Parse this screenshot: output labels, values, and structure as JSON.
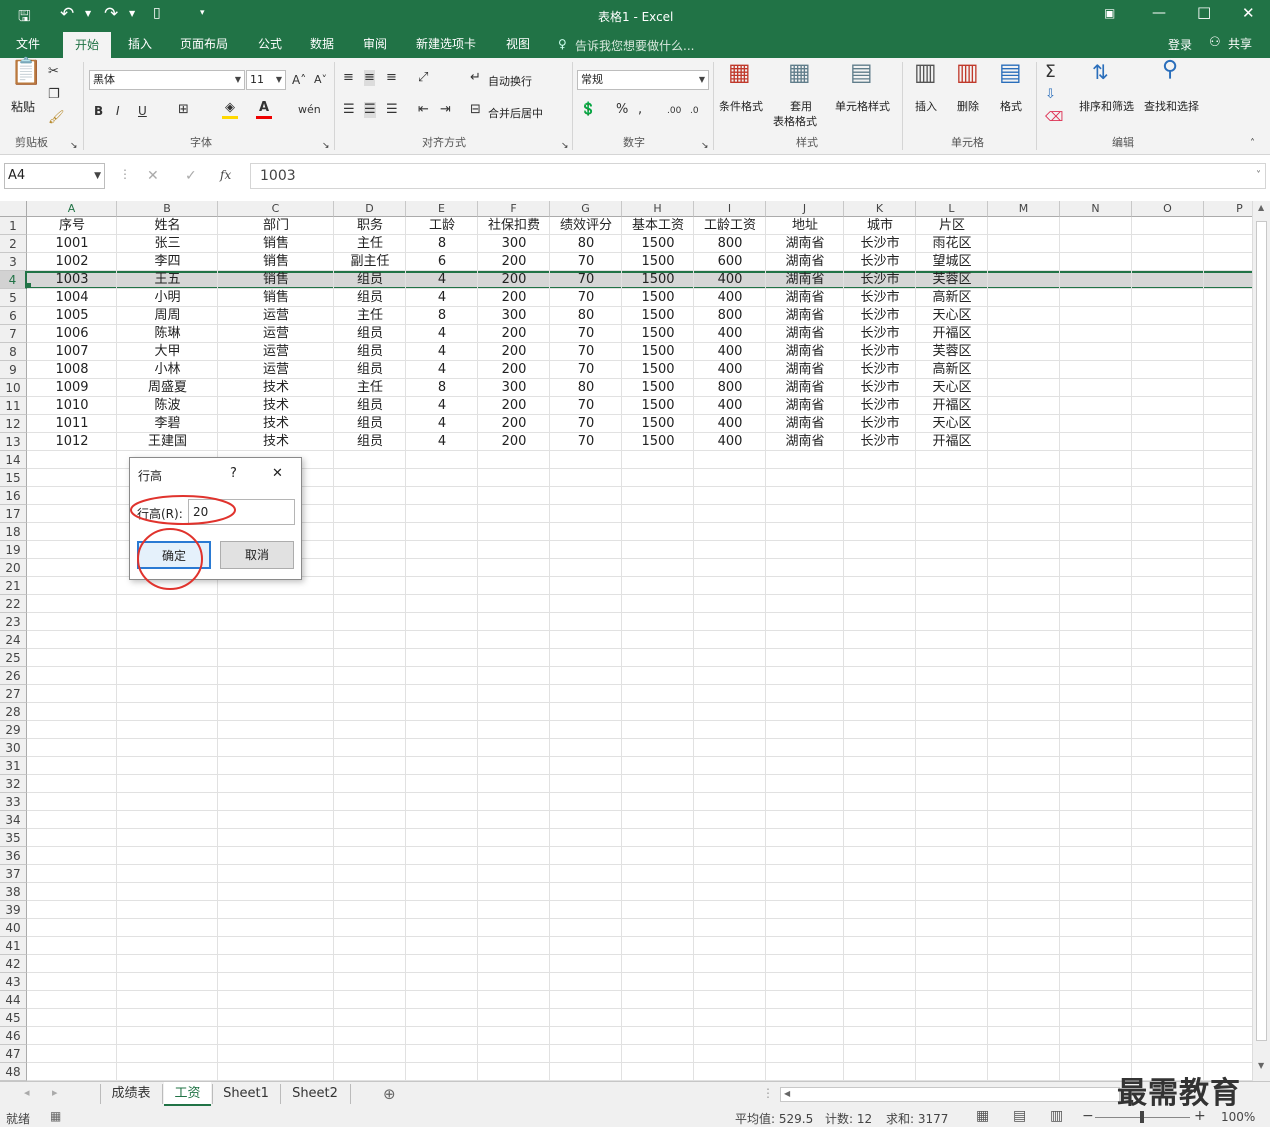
{
  "window": {
    "title": "表格1 - Excel"
  },
  "tabs": [
    "文件",
    "开始",
    "插入",
    "页面布局",
    "公式",
    "数据",
    "审阅",
    "新建选项卡",
    "视图"
  ],
  "tell_me": "告诉我您想要做什么...",
  "account": {
    "login": "登录",
    "share": "共享"
  },
  "ribbon": {
    "clipboard": {
      "label": "剪贴板",
      "paste": "粘贴"
    },
    "font": {
      "label": "字体",
      "name": "黑体",
      "size": "11",
      "bold": "B",
      "italic": "I",
      "underline": "U"
    },
    "alignment": {
      "label": "对齐方式",
      "wrap": "自动换行",
      "merge": "合并后居中"
    },
    "number": {
      "label": "数字",
      "format": "常规",
      "percent": "%"
    },
    "styles": {
      "label": "样式",
      "conditional": "条件格式",
      "table1": "套用",
      "table2": "表格格式",
      "cell_styles": "单元格样式"
    },
    "cells": {
      "label": "单元格",
      "insert": "插入",
      "delete": "删除",
      "format": "格式"
    },
    "editing": {
      "label": "编辑",
      "sort": "排序和筛选",
      "find": "查找和选择"
    }
  },
  "formula_bar": {
    "name_box": "A4",
    "fx": "fx",
    "value": "1003"
  },
  "columns": [
    "A",
    "B",
    "C",
    "D",
    "E",
    "F",
    "G",
    "H",
    "I",
    "J",
    "K",
    "L",
    "M",
    "N",
    "O",
    "P"
  ],
  "table": {
    "headers": [
      "序号",
      "姓名",
      "部门",
      "职务",
      "工龄",
      "社保扣费",
      "绩效评分",
      "基本工资",
      "工龄工资",
      "地址",
      "城市",
      "片区"
    ],
    "rows": [
      [
        "1001",
        "张三",
        "销售",
        "主任",
        "8",
        "300",
        "80",
        "1500",
        "800",
        "湖南省",
        "长沙市",
        "雨花区"
      ],
      [
        "1002",
        "李四",
        "销售",
        "副主任",
        "6",
        "200",
        "70",
        "1500",
        "600",
        "湖南省",
        "长沙市",
        "望城区"
      ],
      [
        "1003",
        "王五",
        "销售",
        "组员",
        "4",
        "200",
        "70",
        "1500",
        "400",
        "湖南省",
        "长沙市",
        "芙蓉区"
      ],
      [
        "1004",
        "小明",
        "销售",
        "组员",
        "4",
        "200",
        "70",
        "1500",
        "400",
        "湖南省",
        "长沙市",
        "高新区"
      ],
      [
        "1005",
        "周周",
        "运营",
        "主任",
        "8",
        "300",
        "80",
        "1500",
        "800",
        "湖南省",
        "长沙市",
        "天心区"
      ],
      [
        "1006",
        "陈琳",
        "运营",
        "组员",
        "4",
        "200",
        "70",
        "1500",
        "400",
        "湖南省",
        "长沙市",
        "开福区"
      ],
      [
        "1007",
        "大甲",
        "运营",
        "组员",
        "4",
        "200",
        "70",
        "1500",
        "400",
        "湖南省",
        "长沙市",
        "芙蓉区"
      ],
      [
        "1008",
        "小林",
        "运营",
        "组员",
        "4",
        "200",
        "70",
        "1500",
        "400",
        "湖南省",
        "长沙市",
        "高新区"
      ],
      [
        "1009",
        "周盛夏",
        "技术",
        "主任",
        "8",
        "300",
        "80",
        "1500",
        "800",
        "湖南省",
        "长沙市",
        "天心区"
      ],
      [
        "1010",
        "陈波",
        "技术",
        "组员",
        "4",
        "200",
        "70",
        "1500",
        "400",
        "湖南省",
        "长沙市",
        "开福区"
      ],
      [
        "1011",
        "李碧",
        "技术",
        "组员",
        "4",
        "200",
        "70",
        "1500",
        "400",
        "湖南省",
        "长沙市",
        "天心区"
      ],
      [
        "1012",
        "王建国",
        "技术",
        "组员",
        "4",
        "200",
        "70",
        "1500",
        "400",
        "湖南省",
        "长沙市",
        "开福区"
      ]
    ]
  },
  "dialog": {
    "title": "行高",
    "help": "?",
    "close": "✕",
    "field_label": "行高(R):",
    "value": "20",
    "ok": "确定",
    "cancel": "取消"
  },
  "sheets": [
    "成绩表",
    "工资",
    "Sheet1",
    "Sheet2"
  ],
  "active_sheet": "工资",
  "status": {
    "ready": "就绪",
    "average": "平均值: 529.5",
    "count": "计数: 12",
    "sum": "求和: 3177",
    "zoom": "100%"
  },
  "watermark": "最需教育"
}
